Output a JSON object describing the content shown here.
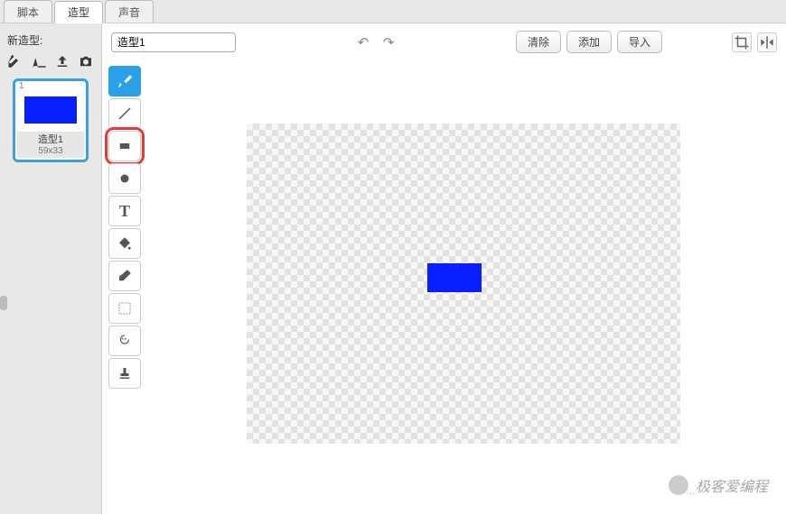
{
  "tabs": {
    "scripts": "脚本",
    "costumes": "造型",
    "sounds": "声音"
  },
  "left": {
    "new_label": "新造型:",
    "thumb": {
      "index": "1",
      "name": "造型1",
      "dims": "59x33"
    }
  },
  "top": {
    "name_value": "造型1",
    "buttons": {
      "clear": "清除",
      "add": "添加",
      "import": "导入"
    }
  },
  "watermark": "极客爱编程"
}
